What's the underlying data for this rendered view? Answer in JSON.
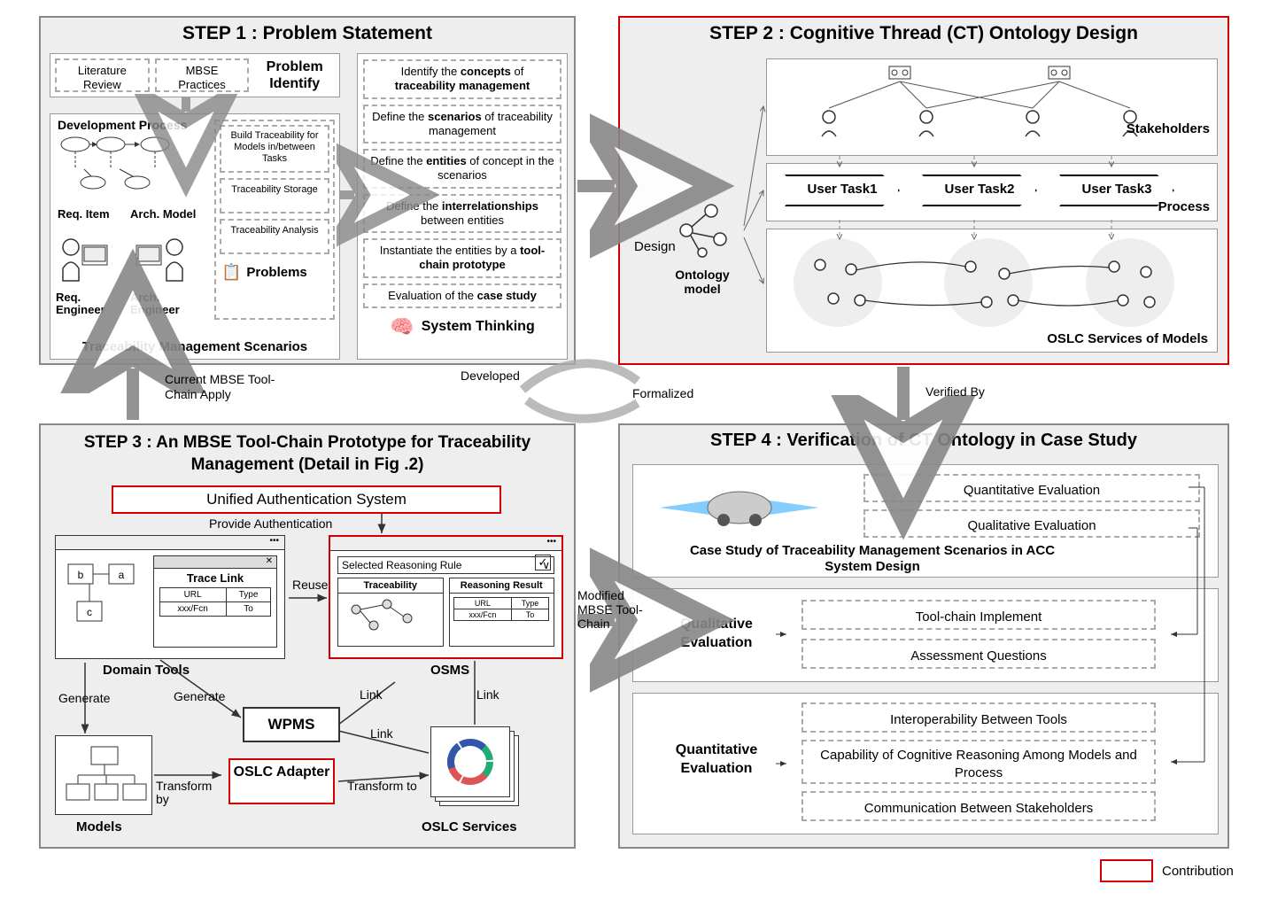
{
  "step1": {
    "title": "STEP 1 : Problem Statement",
    "top_row": {
      "lit": "Literature Review",
      "mbse": "MBSE Practices",
      "probid": "Problem Identify"
    },
    "dev_process": "Development Process",
    "req_item": "Req. Item",
    "arch_model": "Arch. Model",
    "req_eng": "Req. Engineer",
    "arch_eng": "Arch. Engineer",
    "tms": "Traceability Management Scenarios",
    "right_boxes": {
      "b1": "Build Traceability for Models in/between Tasks",
      "b2": "Traceability Storage",
      "b3": "Traceability Analysis"
    },
    "problems": "Problems",
    "col2": {
      "c1a": "Identify the ",
      "c1b": "concepts",
      "c1c": " of ",
      "c1d": "traceability management",
      "c2a": "Define the ",
      "c2b": "scenarios",
      "c2c": " of traceability management",
      "c3a": "Define the ",
      "c3b": "entities",
      "c3c": " of concept in the scenarios",
      "c4a": "Define the ",
      "c4b": "interrelationships",
      "c4c": " between entities",
      "c5a": "Instantiate the entities by a ",
      "c5b": "tool-chain prototype",
      "c6a": "Evaluation of the ",
      "c6b": "case study"
    },
    "sys_think": "System Thinking"
  },
  "step2": {
    "title": "STEP 2 : Cognitive Thread (CT) Ontology Design",
    "design": "Design",
    "ont": "Ontology model",
    "t1": "User Task1",
    "t2": "User Task2",
    "t3": "User Task3",
    "stakeholders": "Stakeholders",
    "process": "Process",
    "oslc": "OSLC Services of Models"
  },
  "step3": {
    "title": "STEP 3 : An MBSE Tool-Chain Prototype for Traceability Management (Detail in Fig .2)",
    "uas": "Unified Authentication System",
    "prov_auth": "Provide Authentication",
    "domain_tools": "Domain Tools",
    "trace_link": "Trace Link",
    "url": "URL",
    "type": "Type",
    "xxxfcn": "xxx/Fcn",
    "to": "To",
    "models": "Models",
    "wpms": "WPMS",
    "oslc_adapter": "OSLC Adapter",
    "oslc_services": "OSLC Services",
    "osms": "OSMS",
    "selected_rule": "Selected Reasoning Rule",
    "traceability": "Traceability",
    "reasoning": "Reasoning Result",
    "reuse": "Reuse",
    "link": "Link",
    "generate": "Generate",
    "transform_by": "Transform by",
    "transform_to": "Transform to"
  },
  "step4": {
    "title": "STEP 4 : Verification of CT Ontology in Case Study",
    "quant_eval": "Quantitative Evaluation",
    "qual_eval": "Qualitative Evaluation",
    "case_study": "Case Study of Traceability Management Scenarios in ACC System Design",
    "toolchain_imp": "Tool-chain Implement",
    "assess_q": "Assessment Questions",
    "interop": "Interoperability Between Tools",
    "cap_reason": "Capability of Cognitive Reasoning Among Models and Process",
    "comm": "Communication Between Stakeholders"
  },
  "arrows": {
    "developed": "Developed",
    "formalized": "Formalized",
    "verified_by": "Verified By",
    "current_mbse": "Current MBSE Tool-Chain Apply",
    "modified_mbse": "Modified MBSE Tool-Chain"
  },
  "legend": {
    "contribution": "Contribution"
  }
}
